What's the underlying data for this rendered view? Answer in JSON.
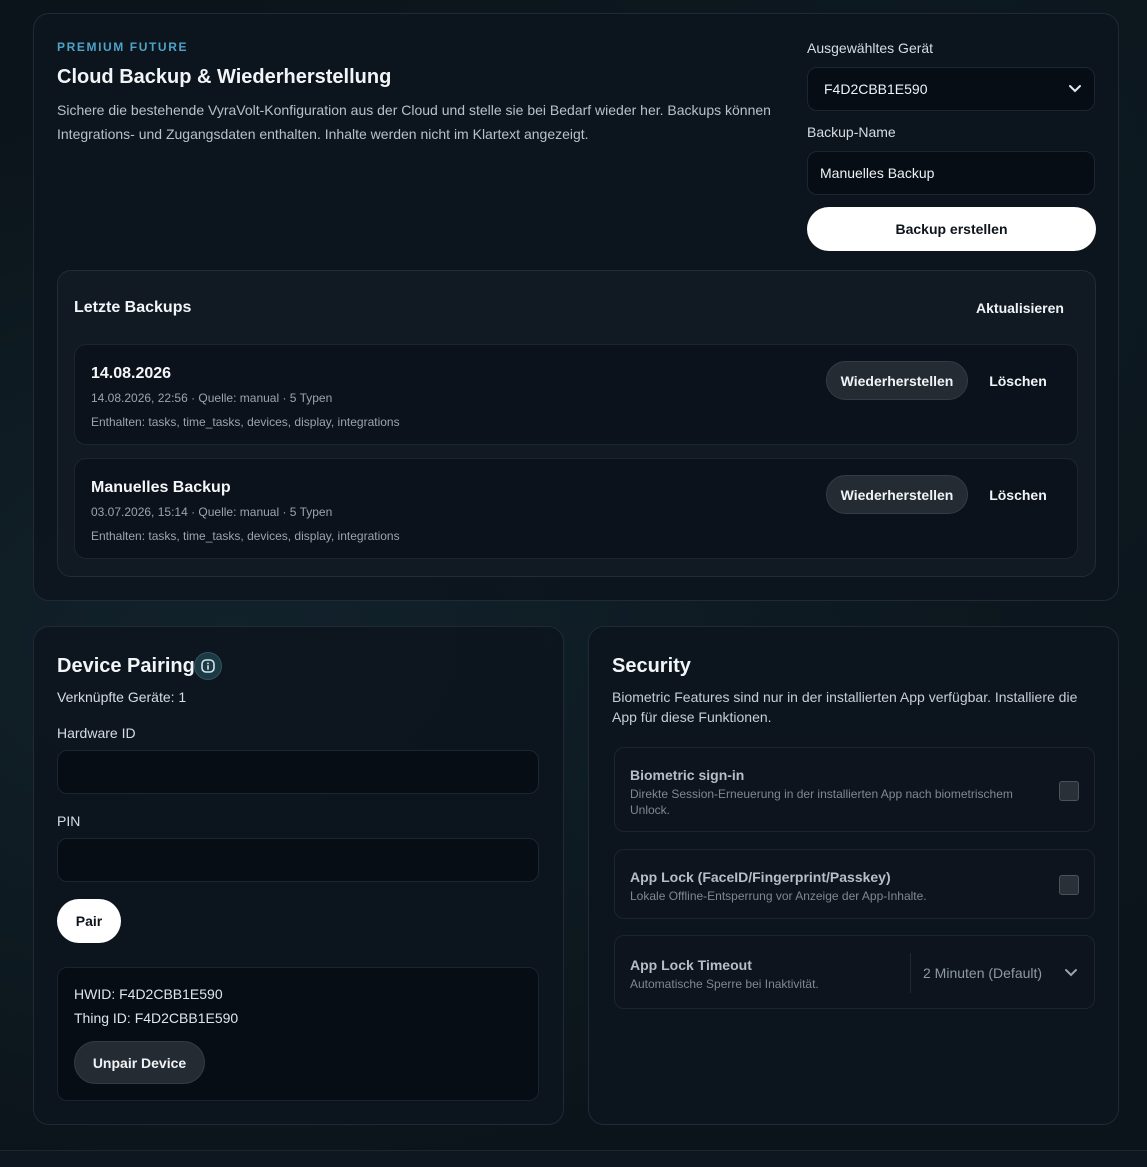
{
  "backup": {
    "eyebrow": "PREMIUM FUTURE",
    "title": "Cloud Backup & Wiederherstellung",
    "description": "Sichere die bestehende VyraVolt-Konfiguration aus der Cloud und stelle sie bei Bedarf wieder her. Backups können Integrations- und Zugangsdaten enthalten. Inhalte werden nicht im Klartext angezeigt.",
    "device_label": "Ausgewähltes Gerät",
    "device_value": "F4D2CBB1E590",
    "name_label": "Backup-Name",
    "name_value": "Manuelles Backup",
    "create_button": "Backup erstellen",
    "recent_title": "Letzte Backups",
    "refresh_button": "Aktualisieren",
    "items": [
      {
        "title": "14.08.2026",
        "meta": "14.08.2026, 22:56 · Quelle: manual · 5 Typen",
        "contents": "Enthalten: tasks, time_tasks, devices, display, integrations",
        "restore": "Wiederherstellen",
        "delete": "Löschen"
      },
      {
        "title": "Manuelles Backup",
        "meta": "03.07.2026, 15:14 · Quelle: manual · 5 Typen",
        "contents": "Enthalten: tasks, time_tasks, devices, display, integrations",
        "restore": "Wiederherstellen",
        "delete": "Löschen"
      }
    ]
  },
  "pairing": {
    "title": "Device Pairing",
    "info_icon": "info-icon",
    "linked": "Verknüpfte Geräte: 1",
    "hwid_label": "Hardware ID",
    "hwid_value": "",
    "pin_label": "PIN",
    "pin_value": "",
    "pair_button": "Pair",
    "hwid_line": "HWID: F4D2CBB1E590",
    "thing_line": "Thing ID: F4D2CBB1E590",
    "unpair_button": "Unpair Device"
  },
  "security": {
    "title": "Security",
    "description": "Biometric Features sind nur in der installierten App verfügbar. Installiere die App für diese Funktionen.",
    "rows": [
      {
        "title": "Biometric sign-in",
        "subtitle": "Direkte Session-Erneuerung in der installierten App nach biometrischem Unlock.",
        "checked": false
      },
      {
        "title": "App Lock (FaceID/Fingerprint/Passkey)",
        "subtitle": "Lokale Offline-Entsperrung vor Anzeige der App-Inhalte.",
        "checked": false
      }
    ],
    "timeout": {
      "title": "App Lock Timeout",
      "subtitle": "Automatische Sperre bei Inaktivität.",
      "value": "2 Minuten (Default)"
    }
  },
  "colors": {
    "accent": "#4da3c7",
    "background": "#0b141a",
    "card": "#0d141e"
  }
}
